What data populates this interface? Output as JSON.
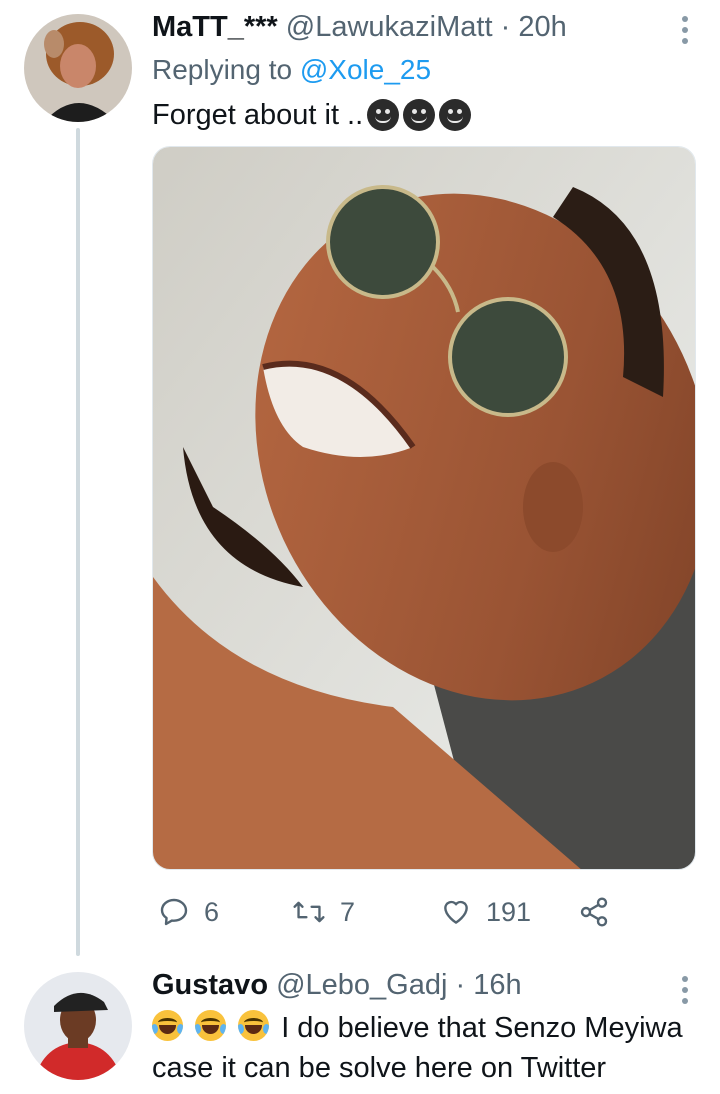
{
  "tweets": [
    {
      "display_name": "MaTT_***",
      "handle": "@LawukaziMatt",
      "time": "20h",
      "replying_prefix": "Replying to",
      "replying_to": "@Xole_25",
      "text": "Forget about it ..",
      "emoji_count": 3,
      "media_description": "Smiling man wearing round sunglasses",
      "actions": {
        "replies": "6",
        "retweets": "7",
        "likes": "191"
      }
    },
    {
      "display_name": "Gustavo",
      "handle": "@Lebo_Gadj",
      "time": "16h",
      "text": "I do believe that Senzo Meyiwa case it can be solve here on Twitter",
      "emoji_count": 3
    }
  ],
  "icons": {
    "reply": "comment-icon",
    "retweet": "retweet-icon",
    "like": "heart-icon",
    "share": "share-icon",
    "more": "more-vertical-icon"
  },
  "colors": {
    "link": "#1d9bf0",
    "secondary_text": "#536471",
    "thread_line": "#cfd9de"
  }
}
